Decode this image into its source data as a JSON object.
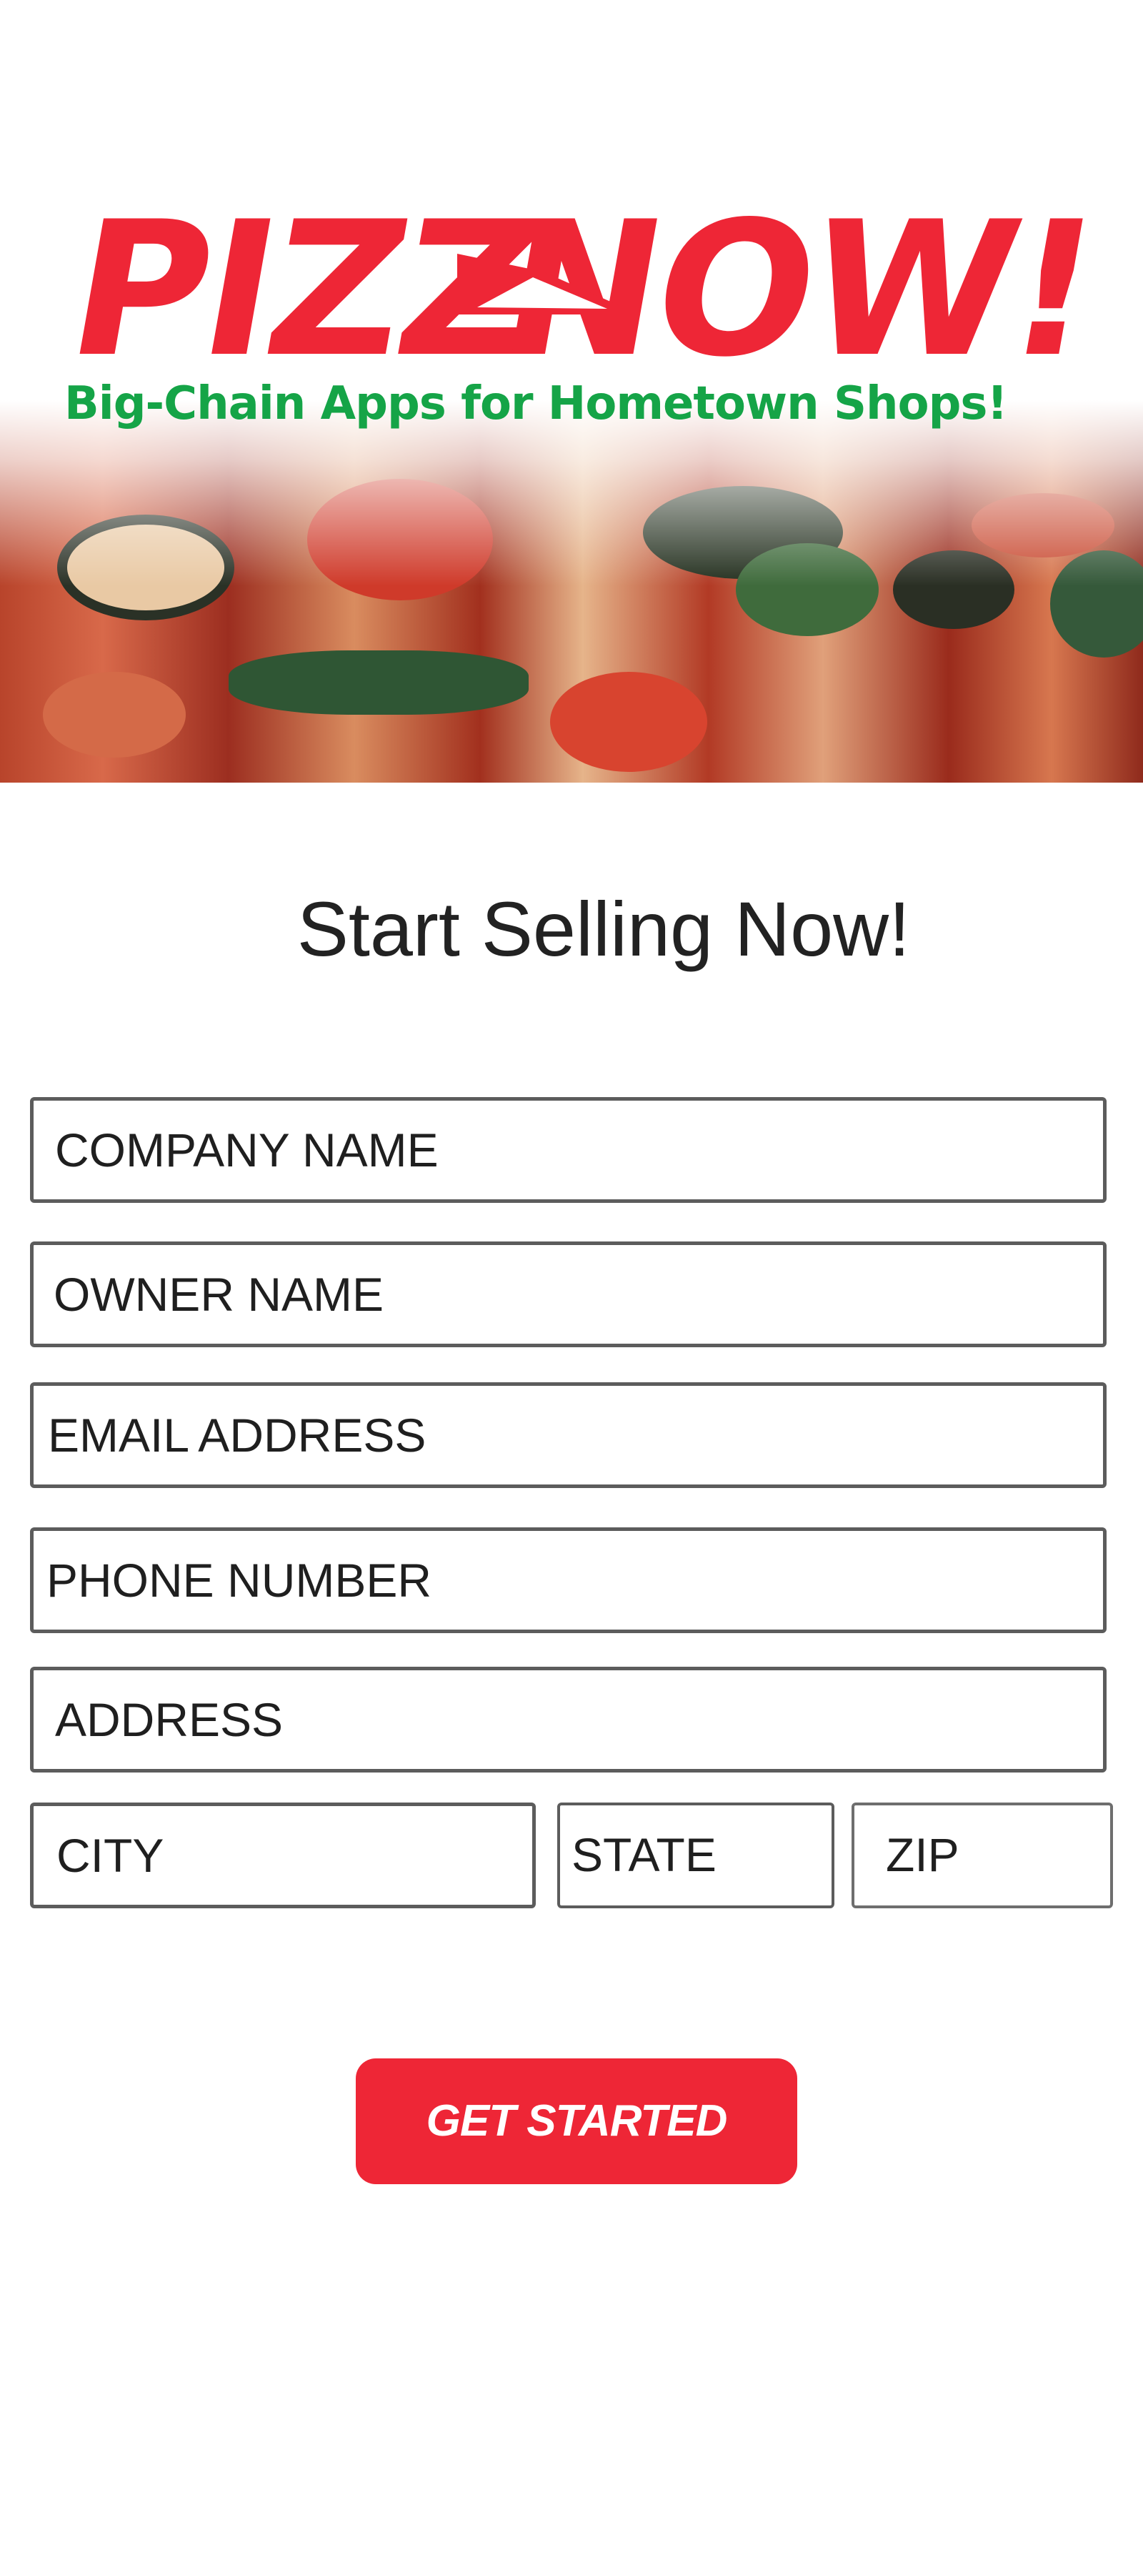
{
  "brand": {
    "logo_text": "PIZZANOW!",
    "tagline": "Big-Chain Apps for Hometown Shops!",
    "colors": {
      "red": "#ee2636",
      "green": "#15a447"
    }
  },
  "form": {
    "title": "Start Selling Now!",
    "fields": {
      "company_name": "COMPANY NAME",
      "owner_name": "OWNER NAME",
      "email": "EMAIL ADDRESS",
      "phone": "PHONE NUMBER",
      "address": "ADDRESS",
      "city": "CITY",
      "state": "STATE",
      "zip": "ZIP"
    },
    "submit_label": "GET STARTED"
  }
}
